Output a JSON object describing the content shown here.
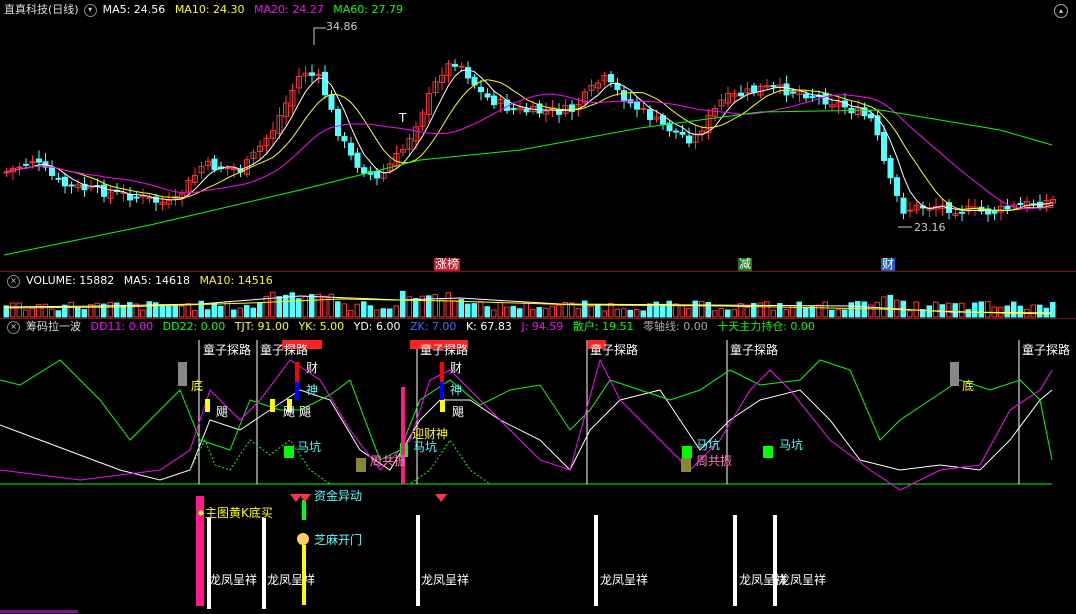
{
  "main_panel": {
    "title": "直真科技(日线)",
    "ma5": "MA5: 24.56",
    "ma10": "MA10: 24.30",
    "ma20": "MA20: 24.27",
    "ma60": "MA60: 27.79",
    "high_label": "34.86",
    "low_label": "23.16",
    "t_marker": "T",
    "badges": [
      "涨榜",
      "减",
      "财"
    ]
  },
  "volume_panel": {
    "volume": "VOLUME: 15882",
    "ma5": "MA5: 14618",
    "ma10": "MA10: 14516"
  },
  "indicator_panel": {
    "title": "筹码拉一波",
    "dd11": "DD11: 0.00",
    "dd22": "DD22: 0.00",
    "tjt": "TJT: 91.00",
    "yk": "YK: 5.00",
    "yd": "YD: 6.00",
    "zk": "ZK: 7.00",
    "k": "K: 67.83",
    "j": "J: 94.59",
    "sanhu": "散户: 19.51",
    "zero_axis": "零轴线: 0.00",
    "ten_day": "十天主力持仓: 0.00",
    "labels": {
      "tongzi": "童子探路",
      "di": "底",
      "ju": "飓",
      "cai": "财",
      "shen": "神",
      "makeng": "马坑",
      "ying_caishen": "迎财神",
      "zhougong": "周共振",
      "zijin": "资金异动",
      "zhutu": "主图黄K底买",
      "zhima": "芝麻开门",
      "longfeng": "龙凤呈祥"
    }
  },
  "colors": {
    "up": "#ff3232",
    "down": "#54ffff",
    "ma5": "#ffffff",
    "ma10": "#ffff00",
    "ma20": "#ff00ff",
    "ma60": "#00ff00"
  }
}
